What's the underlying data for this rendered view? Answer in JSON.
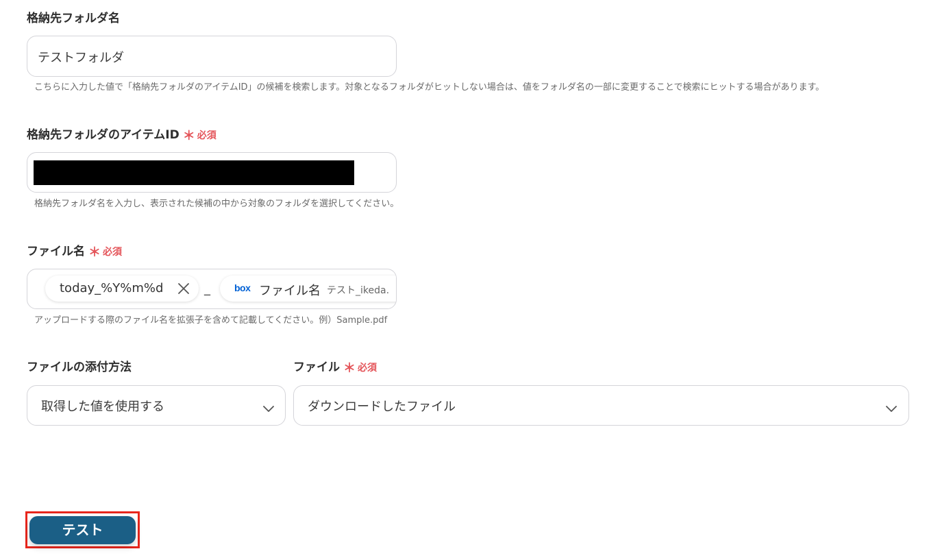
{
  "folder_name": {
    "label": "格納先フォルダ名",
    "value": "テストフォルダ",
    "hint": "こちらに入力した値で「格納先フォルダのアイテムID」の候補を検索します。対象となるフォルダがヒットしない場合は、値をフォルダ名の一部に変更することで検索にヒットする場合があります。"
  },
  "folder_item_id": {
    "label": "格納先フォルダのアイテムID",
    "required_mark": "＊",
    "required_label": "必須",
    "hint": "格納先フォルダ名を入力し、表示された候補の中から対象のフォルダを選択してください。"
  },
  "file_name": {
    "label": "ファイル名",
    "required_mark": "＊",
    "required_label": "必須",
    "chip1": "today_%Y%m%d",
    "separator": "_",
    "chip2_brand": "box",
    "chip2_label": "ファイル名",
    "chip2_value": "テスト_ikeda.",
    "hint": "アップロードする際のファイル名を拡張子を含めて記載してください。例）Sample.pdf"
  },
  "attach_method": {
    "label": "ファイルの添付方法",
    "value": "取得した値を使用する"
  },
  "file": {
    "label": "ファイル",
    "required_mark": "＊",
    "required_label": "必須",
    "value": "ダウンロードしたファイル"
  },
  "test_button": {
    "label": "テスト"
  },
  "colors": {
    "accent_button": "#1b5f86",
    "required": "#e4555a",
    "highlight_outline": "#e8261c",
    "box_brand": "#0061d5"
  }
}
